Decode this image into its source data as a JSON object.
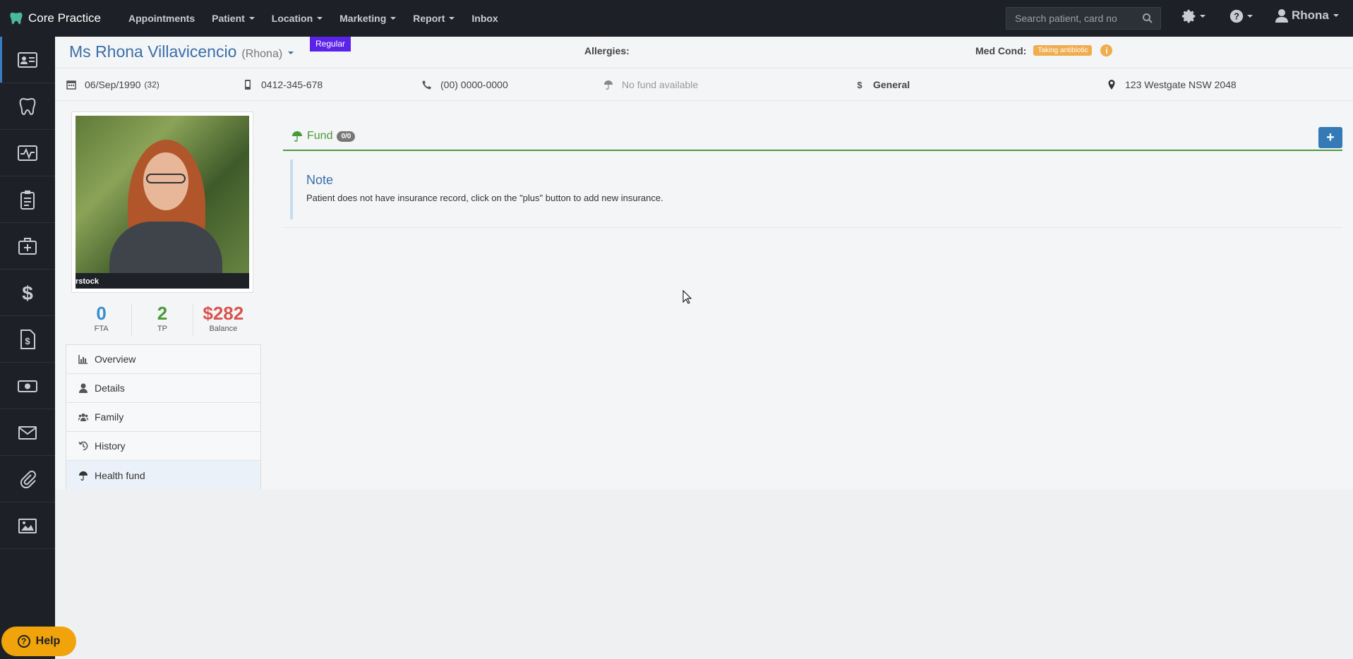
{
  "app": {
    "brand": "Core Practice"
  },
  "nav": [
    {
      "label": "Appointments",
      "caret": false
    },
    {
      "label": "Patient",
      "caret": true
    },
    {
      "label": "Location",
      "caret": true
    },
    {
      "label": "Marketing",
      "caret": true
    },
    {
      "label": "Report",
      "caret": true
    },
    {
      "label": "Inbox",
      "caret": false
    }
  ],
  "search": {
    "placeholder": "Search patient, card no"
  },
  "user": {
    "name": "Rhona"
  },
  "patient": {
    "name": "Ms Rhona Villavicencio",
    "nickname": "(Rhona)",
    "tag": "Regular",
    "allergies_label": "Allergies:",
    "medcond_label": "Med Cond:",
    "medcond_value": "Taking antibiotic",
    "dob": "06/Sep/1990",
    "age": "(32)",
    "mobile": "0412-345-678",
    "phone": "(00) 0000-0000",
    "fund": "No fund available",
    "billing": "General",
    "address": "123 Westgate NSW 2048"
  },
  "stats": [
    {
      "value": "0",
      "label": "FTA",
      "color": "#3a8fc8"
    },
    {
      "value": "2",
      "label": "TP",
      "color": "#4a9a3a"
    },
    {
      "value": "$282",
      "label": "Balance",
      "color": "#d9534f"
    }
  ],
  "menu": [
    {
      "label": "Overview",
      "icon": "chart-icon"
    },
    {
      "label": "Details",
      "icon": "user-icon"
    },
    {
      "label": "Family",
      "icon": "users-icon"
    },
    {
      "label": "History",
      "icon": "history-icon"
    },
    {
      "label": "Health fund",
      "icon": "umbrella-icon"
    }
  ],
  "fund_panel": {
    "title": "Fund",
    "count": "0/0",
    "add_label": "+",
    "note_title": "Note",
    "note_text": "Patient does not have insurance record, click on the \"plus\" button to add new insurance."
  },
  "photo": {
    "watermark": "rstock"
  },
  "help": {
    "label": "Help"
  },
  "colors": {
    "accent": "#337ab7",
    "fund_green": "#4a9a3a",
    "regular_badge": "#5b22e8",
    "medcond_tag": "#f0ad4e"
  }
}
